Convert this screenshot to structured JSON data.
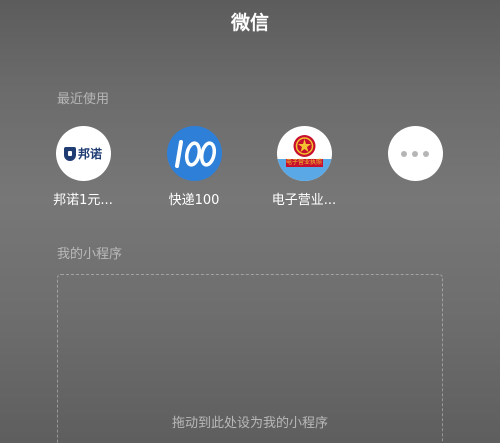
{
  "header": {
    "title": "微信"
  },
  "recent": {
    "label": "最近使用",
    "apps": [
      {
        "name": "邦诺1元...",
        "icon": "bangnuo-logo-icon",
        "logo_text": "邦诺"
      },
      {
        "name": "快递100",
        "icon": "kuaidi100-logo-icon"
      },
      {
        "name": "电子营业...",
        "icon": "business-license-emblem-icon",
        "logo_text": "电子营业执照"
      },
      {
        "name": "",
        "icon": "more-icon"
      }
    ]
  },
  "mine": {
    "label": "我的小程序",
    "drop_hint": "拖动到此处设为我的小程序"
  },
  "colors": {
    "kuaidi_blue": "#2e7fd8",
    "bangnuo_navy": "#1f3d73",
    "emblem_red": "#c8102e",
    "emblem_gold": "#f2c230"
  }
}
